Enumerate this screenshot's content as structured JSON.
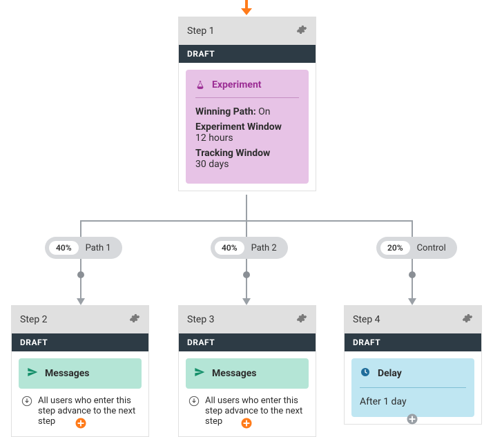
{
  "step1": {
    "title": "Step 1",
    "status": "DRAFT",
    "experiment": {
      "title": "Experiment",
      "winning_path_label": "Winning Path:",
      "winning_path_value": "On",
      "experiment_window_label": "Experiment Window",
      "experiment_window_value": "12 hours",
      "tracking_window_label": "Tracking Window",
      "tracking_window_value": "30 days"
    }
  },
  "paths": {
    "p1": {
      "pct": "40%",
      "label": "Path 1"
    },
    "p2": {
      "pct": "40%",
      "label": "Path 2"
    },
    "p3": {
      "pct": "20%",
      "label": "Control"
    }
  },
  "step2": {
    "title": "Step 2",
    "status": "DRAFT",
    "messages_label": "Messages",
    "advance_text": "All users who enter this step advance to the next step"
  },
  "step3": {
    "title": "Step 3",
    "status": "DRAFT",
    "messages_label": "Messages",
    "advance_text": "All users who enter this step advance to the next step"
  },
  "step4": {
    "title": "Step 4",
    "status": "DRAFT",
    "delay_title": "Delay",
    "delay_value": "After 1 day"
  }
}
